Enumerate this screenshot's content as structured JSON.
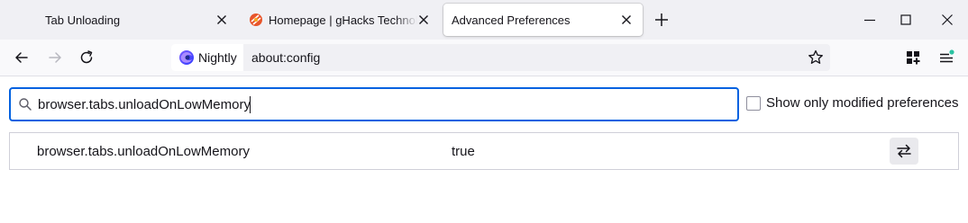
{
  "tabs": [
    {
      "title": "Tab Unloading",
      "active": false
    },
    {
      "title": "Homepage | gHacks Technology News",
      "active": false
    },
    {
      "title": "Advanced Preferences",
      "active": true
    }
  ],
  "urlbar": {
    "identity_label": "Nightly",
    "url": "about:config"
  },
  "search": {
    "value": "browser.tabs.unloadOnLowMemory"
  },
  "filter": {
    "label": "Show only modified preferences",
    "checked": false
  },
  "preferences": [
    {
      "name": "browser.tabs.unloadOnLowMemory",
      "value": "true"
    }
  ],
  "colors": {
    "accent": "#0061e0",
    "tabstrip_bg": "#f0f0f4",
    "toolbar_bg": "#f9f9fb",
    "favicon_ghacks": "#e8552b",
    "menu_badge": "#2ac3a2"
  },
  "icons": {
    "tab_close": "close-icon",
    "new_tab": "plus-icon",
    "back": "arrow-left-icon",
    "forward": "arrow-right-icon",
    "reload": "reload-icon",
    "bookmark": "star-icon",
    "extensions": "extensions-icon",
    "menu": "hamburger-menu-icon",
    "search": "search-icon",
    "toggle": "toggle-arrows-icon"
  }
}
